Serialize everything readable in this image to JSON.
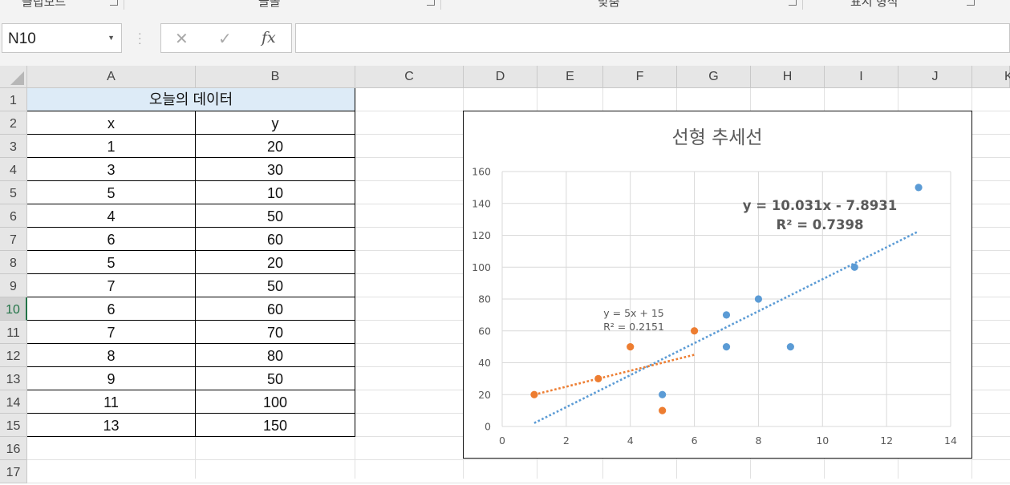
{
  "ribbon": {
    "groups": [
      "클립보드",
      "글꼴",
      "맞춤",
      "표시 형식"
    ]
  },
  "formula_bar": {
    "name_box": "N10",
    "formula_value": ""
  },
  "columns": [
    "A",
    "B",
    "C",
    "D",
    "E",
    "F",
    "G",
    "H",
    "I",
    "J",
    "K"
  ],
  "rows": [
    "1",
    "2",
    "3",
    "4",
    "5",
    "6",
    "7",
    "8",
    "9",
    "10",
    "11",
    "12",
    "13",
    "14",
    "15",
    "16",
    "17"
  ],
  "selected_row": "10",
  "table": {
    "title": "오늘의 데이터",
    "headers": [
      "x",
      "y"
    ],
    "rows": [
      [
        "1",
        "20"
      ],
      [
        "3",
        "30"
      ],
      [
        "5",
        "10"
      ],
      [
        "4",
        "50"
      ],
      [
        "6",
        "60"
      ],
      [
        "5",
        "20"
      ],
      [
        "7",
        "50"
      ],
      [
        "6",
        "60"
      ],
      [
        "7",
        "70"
      ],
      [
        "8",
        "80"
      ],
      [
        "9",
        "50"
      ],
      [
        "11",
        "100"
      ],
      [
        "13",
        "150"
      ]
    ]
  },
  "chart_data": {
    "type": "scatter",
    "title": "선형 추세선",
    "xlim": [
      0,
      14
    ],
    "ylim": [
      0,
      160
    ],
    "x_ticks": [
      "0",
      "2",
      "4",
      "6",
      "8",
      "10",
      "12",
      "14"
    ],
    "y_ticks": [
      "0",
      "20",
      "40",
      "60",
      "80",
      "100",
      "120",
      "140",
      "160"
    ],
    "grid": true,
    "legend": "none",
    "series": [
      {
        "color": "#5b9bd5",
        "points": [
          [
            5,
            20
          ],
          [
            7,
            50
          ],
          [
            7,
            70
          ],
          [
            8,
            80
          ],
          [
            9,
            50
          ],
          [
            11,
            100
          ],
          [
            13,
            150
          ]
        ],
        "trendline": {
          "slope": 10.031,
          "intercept": -7.8931,
          "x_range": [
            1,
            13
          ]
        },
        "equation": "y = 10.031x - 7.8931",
        "r_squared": "R² = 0.7398"
      },
      {
        "color": "#ed7d31",
        "points": [
          [
            1,
            20
          ],
          [
            3,
            30
          ],
          [
            5,
            10
          ],
          [
            4,
            50
          ],
          [
            6,
            60
          ]
        ],
        "trendline": {
          "slope": 5,
          "intercept": 15,
          "x_range": [
            1,
            6
          ]
        },
        "equation": "y = 5x + 15",
        "r_squared": "R² = 0.2151"
      }
    ]
  }
}
